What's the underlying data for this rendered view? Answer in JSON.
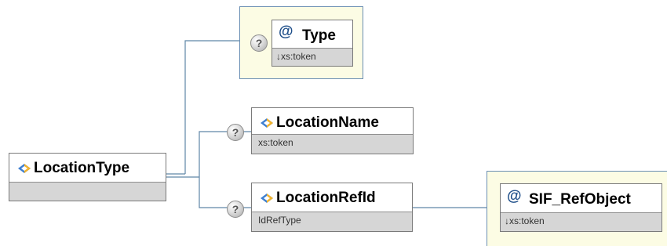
{
  "diagram": {
    "root": {
      "name": "LocationType",
      "icon": "element-icon"
    },
    "type_attribute": {
      "name": "Type",
      "type": "↓xs:token",
      "optional_symbol": "?",
      "attribute_symbol": "@"
    },
    "location_name": {
      "name": "LocationName",
      "type": "xs:token",
      "optional_symbol": "?"
    },
    "location_ref_id": {
      "name": "LocationRefId",
      "type": "IdRefType",
      "optional_symbol": "?"
    },
    "sif_ref_object": {
      "name": "SIF_RefObject",
      "type": "↓xs:token",
      "attribute_symbol": "@"
    },
    "colors": {
      "connector": "#5f86a6",
      "attribute_bg": "#fcfce4",
      "type_bar": "#d6d6d6"
    }
  }
}
